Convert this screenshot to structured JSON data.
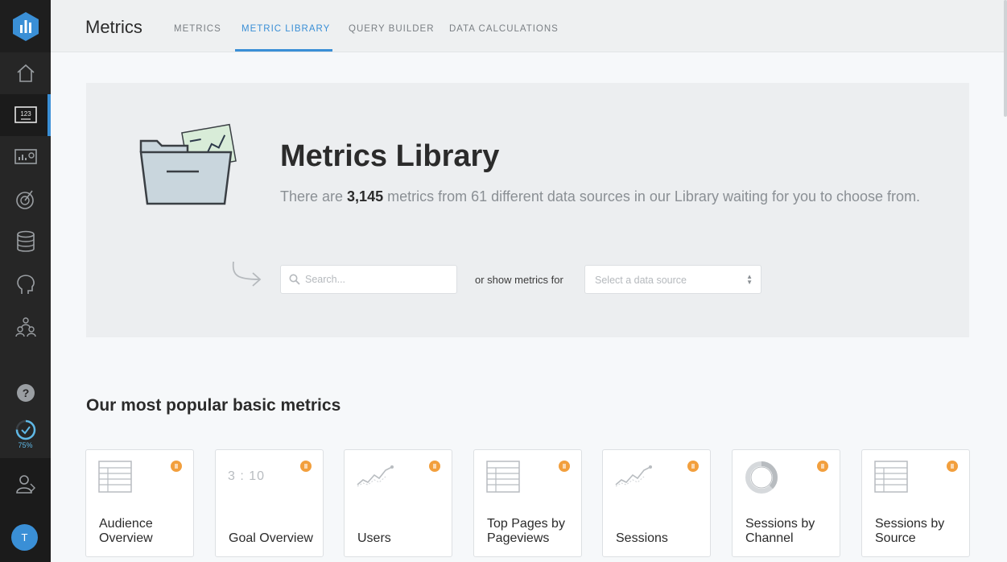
{
  "sidebar": {
    "progress_label": "75%",
    "avatar_initial": "T"
  },
  "header": {
    "title": "Metrics",
    "tabs": [
      {
        "label": "METRICS"
      },
      {
        "label": "METRIC LIBRARY"
      },
      {
        "label": "QUERY BUILDER"
      },
      {
        "label": "DATA CALCULATIONS"
      }
    ],
    "active_tab": "METRIC LIBRARY"
  },
  "hero": {
    "title": "Metrics Library",
    "text_before": "There are ",
    "metric_count": "3,145",
    "text_after": " metrics from 61 different data sources in our Library waiting for you to choose from.",
    "search_placeholder": "Search...",
    "or_text": "or show metrics for",
    "select_placeholder": "Select a data source"
  },
  "section": {
    "title": "Our most popular basic metrics"
  },
  "cards": [
    {
      "label_line1": "Audience",
      "label_line2": "Overview",
      "icon": "table-icon"
    },
    {
      "label_line1": "",
      "label_line2": "Goal Overview",
      "icon": "number-icon",
      "icon_text": "3 : 10"
    },
    {
      "label_line1": "",
      "label_line2": "Users",
      "icon": "line-chart-icon"
    },
    {
      "label_line1": "Top Pages by",
      "label_line2": "Pageviews",
      "icon": "table-icon"
    },
    {
      "label_line1": "",
      "label_line2": "Sessions",
      "icon": "line-chart-icon"
    },
    {
      "label_line1": "Sessions by",
      "label_line2": "Channel",
      "icon": "donut-chart-icon"
    },
    {
      "label_line1": "Sessions by",
      "label_line2": "Source",
      "icon": "table-icon"
    }
  ],
  "colors": {
    "accent": "#3a8fd6",
    "sidebar": "#262626",
    "badge": "#f29f3d"
  }
}
